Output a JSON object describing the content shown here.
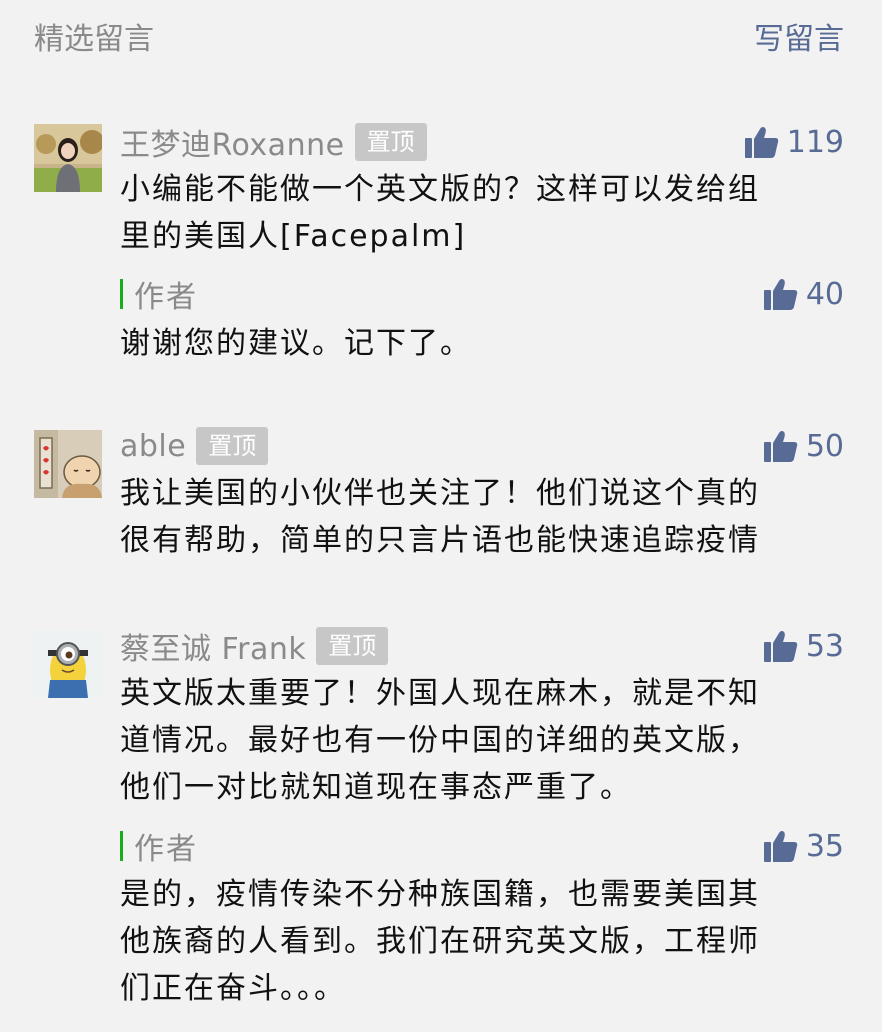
{
  "header": {
    "title": "精选留言",
    "write_label": "写留言"
  },
  "comments": [
    {
      "nickname": "王梦迪Roxanne",
      "badge": "置顶",
      "likes": "119",
      "text_lines": [
        "小编能不能做一个英文版的？这样可以发给组",
        "里的美国人[Facepalm]"
      ],
      "reply": {
        "author_label": "作者",
        "likes": "40",
        "text_lines": [
          "谢谢您的建议。记下了。"
        ]
      }
    },
    {
      "nickname": "able",
      "badge": "置顶",
      "likes": "50",
      "text_lines": [
        "我让美国的小伙伴也关注了！他们说这个真的",
        "很有帮助，简单的只言片语也能快速追踪疫情"
      ]
    },
    {
      "nickname": "蔡至诚 Frank",
      "badge": "置顶",
      "likes": "53",
      "text_lines": [
        "英文版太重要了！外国人现在麻木，就是不知",
        "道情况。最好也有一份中国的详细的英文版，",
        "他们一对比就知道现在事态严重了。"
      ],
      "reply": {
        "author_label": "作者",
        "likes": "35",
        "text_lines": [
          "是的，疫情传染不分种族国籍，也需要美国其",
          "他族裔的人看到。我们在研究英文版，工程师",
          "们正在奋斗。。。"
        ]
      }
    }
  ],
  "colors": {
    "background": "#f2f2f2",
    "link_blue": "#576b95",
    "gray_text": "#8a8a8a",
    "badge_bg": "#c7c7c7",
    "author_bar": "#1aad19"
  },
  "icons": {
    "like": "thumbs-up-icon"
  }
}
